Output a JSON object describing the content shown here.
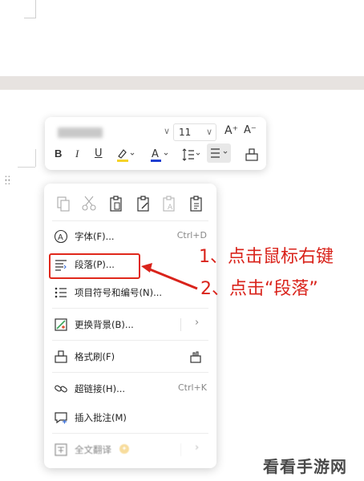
{
  "toolbar": {
    "font_size": "11",
    "grow_font_glyph": "A⁺",
    "shrink_font_glyph": "A⁻",
    "bold_glyph": "B",
    "italic_glyph": "I",
    "underline_glyph": "U",
    "highlight_color": "#f5d329",
    "font_color": "#1f3fd1"
  },
  "context_menu": {
    "clipboard_icons": [
      "copy-icon",
      "cut-icon",
      "paste-icon",
      "paste-text-icon",
      "paste-format-icon",
      "paste-special-icon"
    ],
    "items": [
      {
        "label": "字体(F)...",
        "shortcut": "Ctrl+D",
        "icon": "font-icon"
      },
      {
        "label": "段落(P)...",
        "shortcut": "",
        "icon": "paragraph-icon"
      },
      {
        "label": "项目符号和编号(N)...",
        "shortcut": "",
        "icon": "bullet-list-icon"
      },
      {
        "label": "更换背景(B)...",
        "shortcut": "",
        "icon": "background-icon",
        "submenu": "›"
      },
      {
        "label": "格式刷(F)",
        "shortcut": "",
        "icon": "format-painter-icon"
      },
      {
        "label": "超链接(H)...",
        "shortcut": "Ctrl+K",
        "icon": "hyperlink-icon"
      },
      {
        "label": "插入批注(M)",
        "shortcut": "",
        "icon": "comment-icon"
      },
      {
        "label": "全文翻译",
        "shortcut": "",
        "icon": "translate-icon",
        "submenu": "›"
      }
    ]
  },
  "annotations": {
    "step1": "1、点击鼠标右键",
    "step2": "2、点击“段落”"
  },
  "colors": {
    "accent_red": "#d9231b",
    "gap_band": "#e7e3e0"
  },
  "watermark": "看看手游网"
}
